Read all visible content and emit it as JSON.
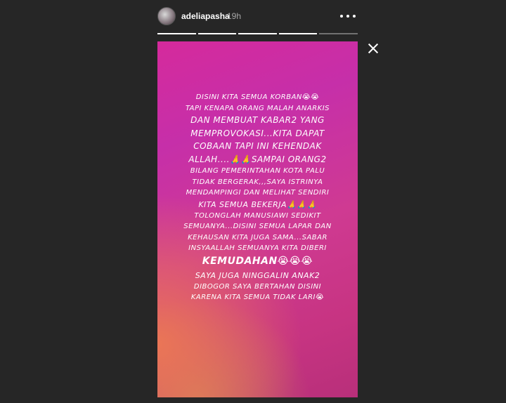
{
  "header": {
    "username": "adeliapasha",
    "time": "19h"
  },
  "progress": {
    "segments": [
      1,
      1,
      1,
      1,
      0
    ],
    "active_index": 4
  },
  "icons": {
    "avatar": "profile-avatar",
    "more": "more-horizontal-icon",
    "close": "close-icon"
  },
  "story": {
    "colors": {
      "top": "#c62fa9",
      "bottom_left": "#ec7854"
    },
    "lines": [
      "DISINI KITA SEMUA KORBAN😭😭",
      "TAPI KENAPA ORANG MALAH ANARKIS",
      "DAN MEMBUAT KABAR2 YANG",
      "MEMPROVOKASI...KITA DAPAT",
      "COBAAN TAPI INI KEHENDAK",
      "ALLAH....🙏🙏SAMPAI ORANG2",
      "BILANG PEMERINTAHAN KOTA PALU",
      "TIDAK BERGERAK,,,SAYA ISTRINYA",
      "MENDAMPINGI DAN MELIHAT SENDIRI",
      "KITA SEMUA BEKERJA🙏🙏🙏",
      "TOLONGLAH MANUSIAWI SEDIKIT",
      "SEMUANYA...DISINI SEMUA LAPAR DAN",
      "KEHAUSAN KITA JUGA SAMA...SABAR",
      "INSYAALLAH SEMUANYA KITA DIBERI",
      "KEMUDAHAN😭😭😭",
      "SAYA JUGA NINGGALIN ANAK2",
      "DIBOGOR SAYA BERTAHAN DISINI",
      "KARENA KITA SEMUA TIDAK LARI😭"
    ]
  }
}
